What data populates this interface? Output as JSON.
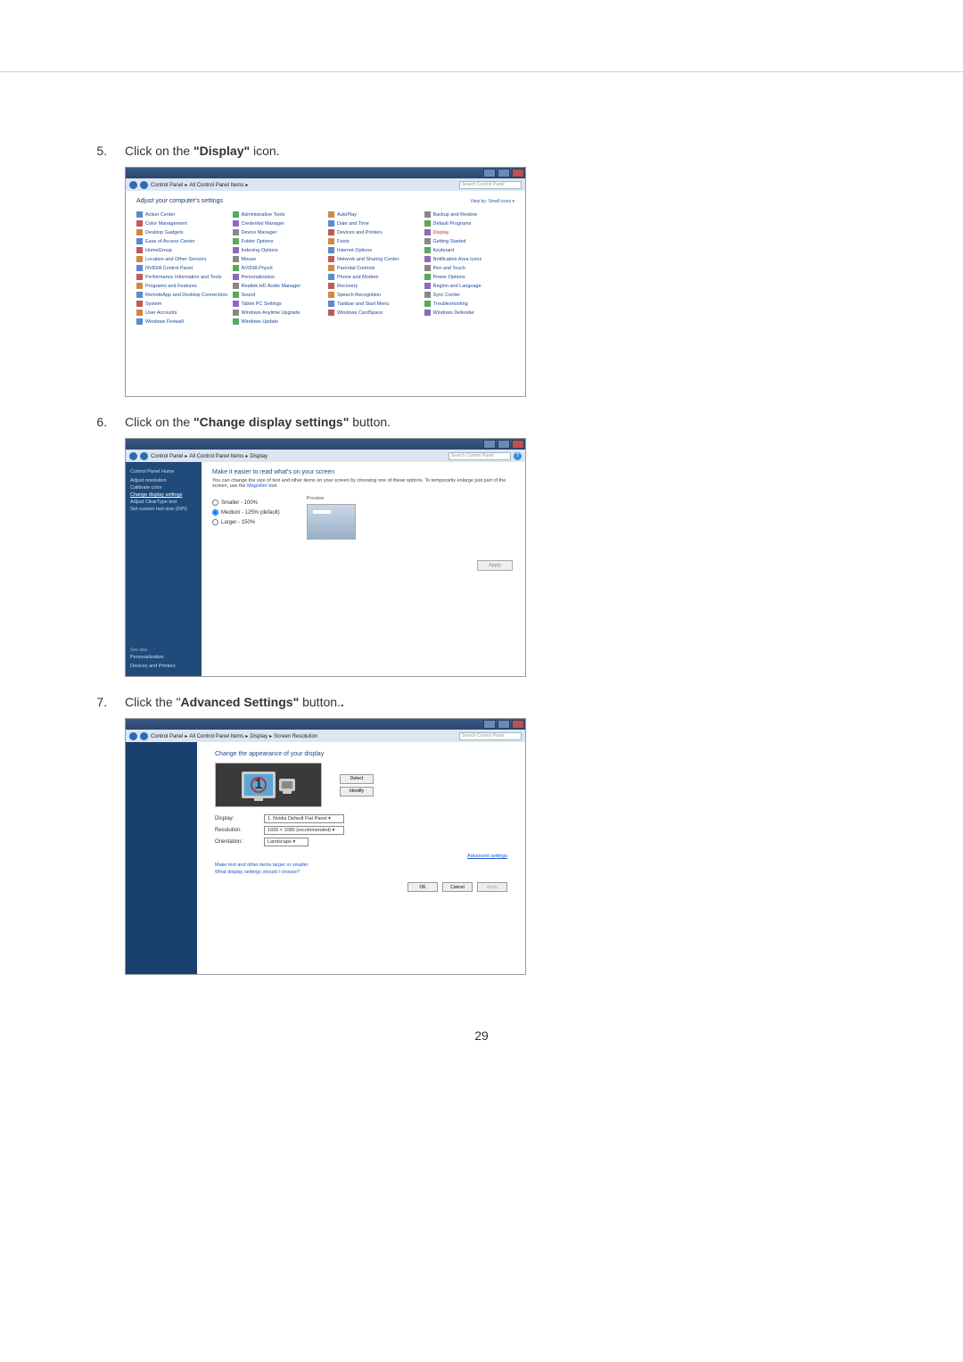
{
  "page_number": "29",
  "steps": [
    {
      "num": "5.",
      "prefix": "Click on the ",
      "bold": "\"Display\"",
      "suffix": " icon."
    },
    {
      "num": "6.",
      "prefix": "Click on the ",
      "bold": "\"Change display settings\"",
      "suffix": " button."
    },
    {
      "num": "7.",
      "prefix": "Click the \"",
      "bold": "Advanced Settings\"",
      "suffix": " button."
    }
  ],
  "s1": {
    "breadcrumb": [
      "Control Panel",
      "All Control Panel Items"
    ],
    "search_placeholder": "Search Control Panel",
    "heading": "Adjust your computer's settings",
    "viewby": "View by:  Small icons ▾",
    "items": [
      "Action Center",
      "Administrative Tools",
      "AutoPlay",
      "Backup and Restore",
      "Color Management",
      "Credential Manager",
      "Date and Time",
      "Default Programs",
      "Desktop Gadgets",
      "Device Manager",
      "Devices and Printers",
      "Display",
      "Ease of Access Center",
      "Folder Options",
      "Fonts",
      "Getting Started",
      "HomeGroup",
      "Indexing Options",
      "Internet Options",
      "Keyboard",
      "Location and Other Sensors",
      "Mouse",
      "Network and Sharing Center",
      "Notification Area Icons",
      "NVIDIA Control Panel",
      "NVIDIA PhysX",
      "Parental Controls",
      "Pen and Touch",
      "Performance Information and Tools",
      "Personalization",
      "Phone and Modem",
      "Power Options",
      "Programs and Features",
      "Realtek HD Audio Manager",
      "Recovery",
      "Region and Language",
      "RemoteApp and Desktop Connections",
      "Sound",
      "Speech Recognition",
      "Sync Center",
      "System",
      "Tablet PC Settings",
      "Taskbar and Start Menu",
      "Troubleshooting",
      "User Accounts",
      "Windows Anytime Upgrade",
      "Windows CardSpace",
      "Windows Defender",
      "Windows Firewall",
      "Windows Update"
    ],
    "highlight_index": 11
  },
  "s2": {
    "breadcrumb": [
      "Control Panel",
      "All Control Panel Items",
      "Display"
    ],
    "search_placeholder": "Search Control Panel",
    "side": {
      "home": "Control Panel Home",
      "links": [
        "Adjust resolution",
        "Calibrate color",
        "Change display settings",
        "Adjust ClearType text",
        "Set custom text size (DPI)"
      ],
      "highlight_index": 2,
      "seealso_title": "See also",
      "seealso": [
        "Personalization",
        "Devices and Printers"
      ]
    },
    "title": "Make it easier to read what's on your screen",
    "desc_pre": "You can change the size of text and other items on your screen by choosing one of these options. To temporarily enlarge just part of the screen, use the ",
    "desc_link": "Magnifier",
    "desc_post": " tool.",
    "radios": [
      "Smaller - 100%",
      "Medium - 125% (default)",
      "Larger - 150%"
    ],
    "radio_checked": 1,
    "preview_label": "Preview",
    "apply": "Apply"
  },
  "s3": {
    "breadcrumb": [
      "Control Panel",
      "All Control Panel Items",
      "Display",
      "Screen Resolution"
    ],
    "search_placeholder": "Search Control Panel",
    "title": "Change the appearance of your display",
    "btn_detect": "Detect",
    "btn_identify": "Identify",
    "fields": {
      "display_label": "Display:",
      "display_value": "1. Nvidia Default Flat Panel ▾",
      "resolution_label": "Resolution:",
      "resolution_value": "1920 × 1080 (recommended)  ▾",
      "orientation_label": "Orientation:",
      "orientation_value": "Landscape  ▾"
    },
    "adv_link": "Advanced settings",
    "help1": "Make text and other items larger or smaller",
    "help2": "What display settings should I choose?",
    "ok": "OK",
    "cancel": "Cancel",
    "apply": "Apply"
  }
}
